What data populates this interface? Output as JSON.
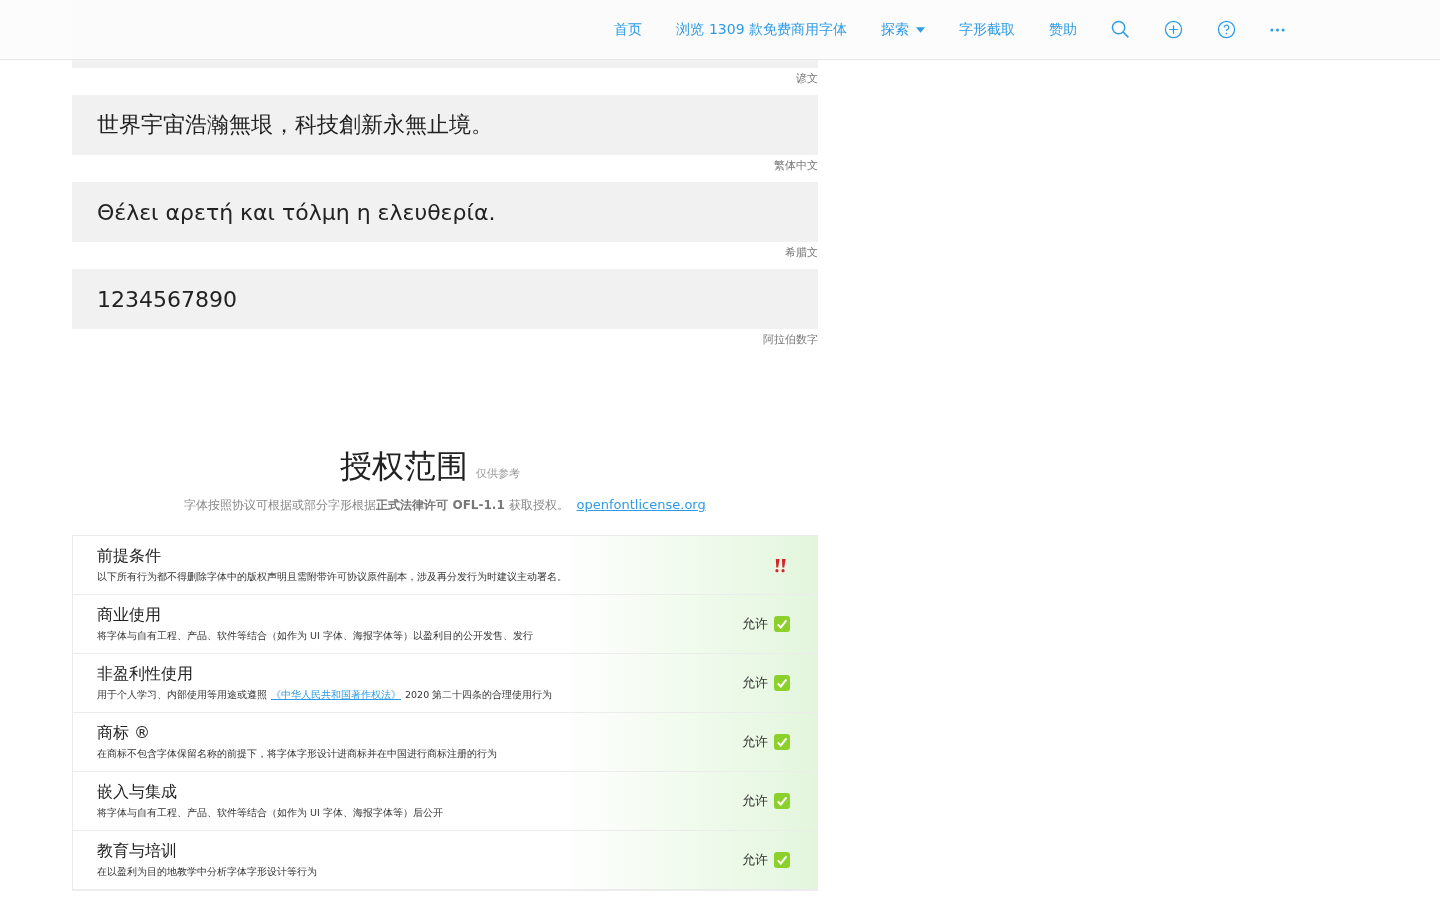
{
  "nav": {
    "items": [
      {
        "label": "首页",
        "dropdown": false
      },
      {
        "label": "浏览 1309 款免费商用字体",
        "dropdown": false
      },
      {
        "label": "探索",
        "dropdown": true
      },
      {
        "label": "字形截取",
        "dropdown": false
      },
      {
        "label": "赞助",
        "dropdown": false
      }
    ]
  },
  "samples": [
    {
      "language": "谚文",
      "kind": "latin"
    },
    {
      "text": "世界宇宙浩瀚無垠，科技創新永無止境。",
      "language": "繁体中文",
      "kind": "cjk"
    },
    {
      "text": "Θέλει αρετή και τόλμη η ελευθερία.",
      "language": "希腊文",
      "kind": "latin"
    },
    {
      "text": "1234567890",
      "language": "阿拉伯数字",
      "kind": "latin"
    }
  ],
  "license": {
    "title": "授权范围",
    "note": "仅供参考",
    "description": "字体按照协议可根据或部分字形根据**正式法律许可 OFL-1.1** 获取授权。",
    "link": "openfontlicense.org",
    "rows": [
      {
        "title": "前提条件",
        "description": [
          {
            "text": "以下所有行为都不得删除字体中的版权声明且需附带许可协议原件副本，涉及再分发行为时建议主动署名。",
            "link": false
          }
        ],
        "kind": "notice"
      },
      {
        "title": "商业使用",
        "description": [
          {
            "text": "将字体与自有工程、产品、软件等结合（如作为 UI 字体、海报字体等）以盈利目的公开发售、发行",
            "link": false
          }
        ],
        "kind": "permission",
        "status": "允许",
        "allowed": true
      },
      {
        "title": "非盈利性使用",
        "description": [
          {
            "text": "用于个人学习、内部使用等用途或遵照",
            "link": false
          },
          {
            "text": "《中华人民共和国著作权法》",
            "link": true
          },
          {
            "text": "2020 第二十四条的合理使用行为",
            "link": false
          }
        ],
        "kind": "permission",
        "status": "允许",
        "allowed": true
      },
      {
        "title": "商标 ®",
        "description": [
          {
            "text": "在商标不包含字体保留名称的前提下，将字体字形设计进商标并在中国进行商标注册的行为",
            "link": false
          }
        ],
        "kind": "permission",
        "status": "允许",
        "allowed": true
      },
      {
        "title": "嵌入与集成",
        "description": [
          {
            "text": "将字体与自有工程、产品、软件等结合（如作为 UI 字体、海报字体等）后公开",
            "link": false
          }
        ],
        "kind": "permission",
        "status": "允许",
        "allowed": true
      },
      {
        "title": "教育与培训",
        "description": [
          {
            "text": "在以盈利为目的地教学中分析字体字形设计等行为",
            "link": false
          }
        ],
        "kind": "permission",
        "status": "允许",
        "allowed": true
      }
    ]
  }
}
